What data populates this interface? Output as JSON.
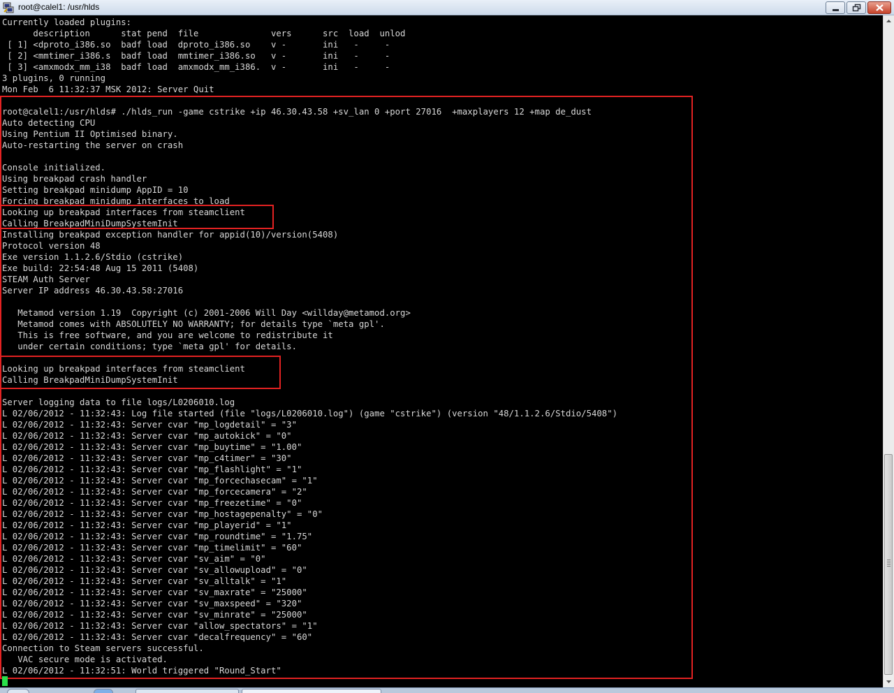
{
  "window": {
    "title": "root@calel1: /usr/hlds",
    "controls": {
      "minimize": "minimize-icon",
      "maximize": "restore-icon",
      "close": "close-icon"
    }
  },
  "terminal": {
    "text_color": "#d8d8d8",
    "background_color": "#000000",
    "highlight_color": "#e32222",
    "cursor_color": "#29e04a",
    "lines": [
      "Currently loaded plugins:",
      "      description      stat pend  file              vers      src  load  unlod",
      " [ 1] <dproto_i386.so  badf load  dproto_i386.so    v -       ini   -     -",
      " [ 2] <mmtimer_i386.s  badf load  mmtimer_i386.so   v -       ini   -     -",
      " [ 3] <amxmodx_mm_i38  badf load  amxmodx_mm_i386.  v -       ini   -     -",
      "3 plugins, 0 running",
      "Mon Feb  6 11:32:37 MSK 2012: Server Quit",
      "",
      "root@calel1:/usr/hlds# ./hlds_run -game cstrike +ip 46.30.43.58 +sv_lan 0 +port 27016  +maxplayers 12 +map de_dust",
      "Auto detecting CPU",
      "Using Pentium II Optimised binary.",
      "Auto-restarting the server on crash",
      "",
      "Console initialized.",
      "Using breakpad crash handler",
      "Setting breakpad minidump AppID = 10",
      "Forcing breakpad minidump interfaces to load",
      "Looking up breakpad interfaces from steamclient",
      "Calling BreakpadMiniDumpSystemInit",
      "Installing breakpad exception handler for appid(10)/version(5408)",
      "Protocol version 48",
      "Exe version 1.1.2.6/Stdio (cstrike)",
      "Exe build: 22:54:48 Aug 15 2011 (5408)",
      "STEAM Auth Server",
      "Server IP address 46.30.43.58:27016",
      "",
      "   Metamod version 1.19  Copyright (c) 2001-2006 Will Day <willday@metamod.org>",
      "   Metamod comes with ABSOLUTELY NO WARRANTY; for details type `meta gpl'.",
      "   This is free software, and you are welcome to redistribute it",
      "   under certain conditions; type `meta gpl' for details.",
      "",
      "Looking up breakpad interfaces from steamclient",
      "Calling BreakpadMiniDumpSystemInit",
      "",
      "Server logging data to file logs/L0206010.log",
      "L 02/06/2012 - 11:32:43: Log file started (file \"logs/L0206010.log\") (game \"cstrike\") (version \"48/1.1.2.6/Stdio/5408\")",
      "L 02/06/2012 - 11:32:43: Server cvar \"mp_logdetail\" = \"3\"",
      "L 02/06/2012 - 11:32:43: Server cvar \"mp_autokick\" = \"0\"",
      "L 02/06/2012 - 11:32:43: Server cvar \"mp_buytime\" = \"1.00\"",
      "L 02/06/2012 - 11:32:43: Server cvar \"mp_c4timer\" = \"30\"",
      "L 02/06/2012 - 11:32:43: Server cvar \"mp_flashlight\" = \"1\"",
      "L 02/06/2012 - 11:32:43: Server cvar \"mp_forcechasecam\" = \"1\"",
      "L 02/06/2012 - 11:32:43: Server cvar \"mp_forcecamera\" = \"2\"",
      "L 02/06/2012 - 11:32:43: Server cvar \"mp_freezetime\" = \"0\"",
      "L 02/06/2012 - 11:32:43: Server cvar \"mp_hostagepenalty\" = \"0\"",
      "L 02/06/2012 - 11:32:43: Server cvar \"mp_playerid\" = \"1\"",
      "L 02/06/2012 - 11:32:43: Server cvar \"mp_roundtime\" = \"1.75\"",
      "L 02/06/2012 - 11:32:43: Server cvar \"mp_timelimit\" = \"60\"",
      "L 02/06/2012 - 11:32:43: Server cvar \"sv_aim\" = \"0\"",
      "L 02/06/2012 - 11:32:43: Server cvar \"sv_allowupload\" = \"0\"",
      "L 02/06/2012 - 11:32:43: Server cvar \"sv_alltalk\" = \"1\"",
      "L 02/06/2012 - 11:32:43: Server cvar \"sv_maxrate\" = \"25000\"",
      "L 02/06/2012 - 11:32:43: Server cvar \"sv_maxspeed\" = \"320\"",
      "L 02/06/2012 - 11:32:43: Server cvar \"sv_minrate\" = \"25000\"",
      "L 02/06/2012 - 11:32:43: Server cvar \"allow_spectators\" = \"1\"",
      "L 02/06/2012 - 11:32:43: Server cvar \"decalfrequency\" = \"60\"",
      "Connection to Steam servers successful.",
      "   VAC secure mode is activated.",
      "L 02/06/2012 - 11:32:51: World triggered \"Round_Start\""
    ]
  }
}
